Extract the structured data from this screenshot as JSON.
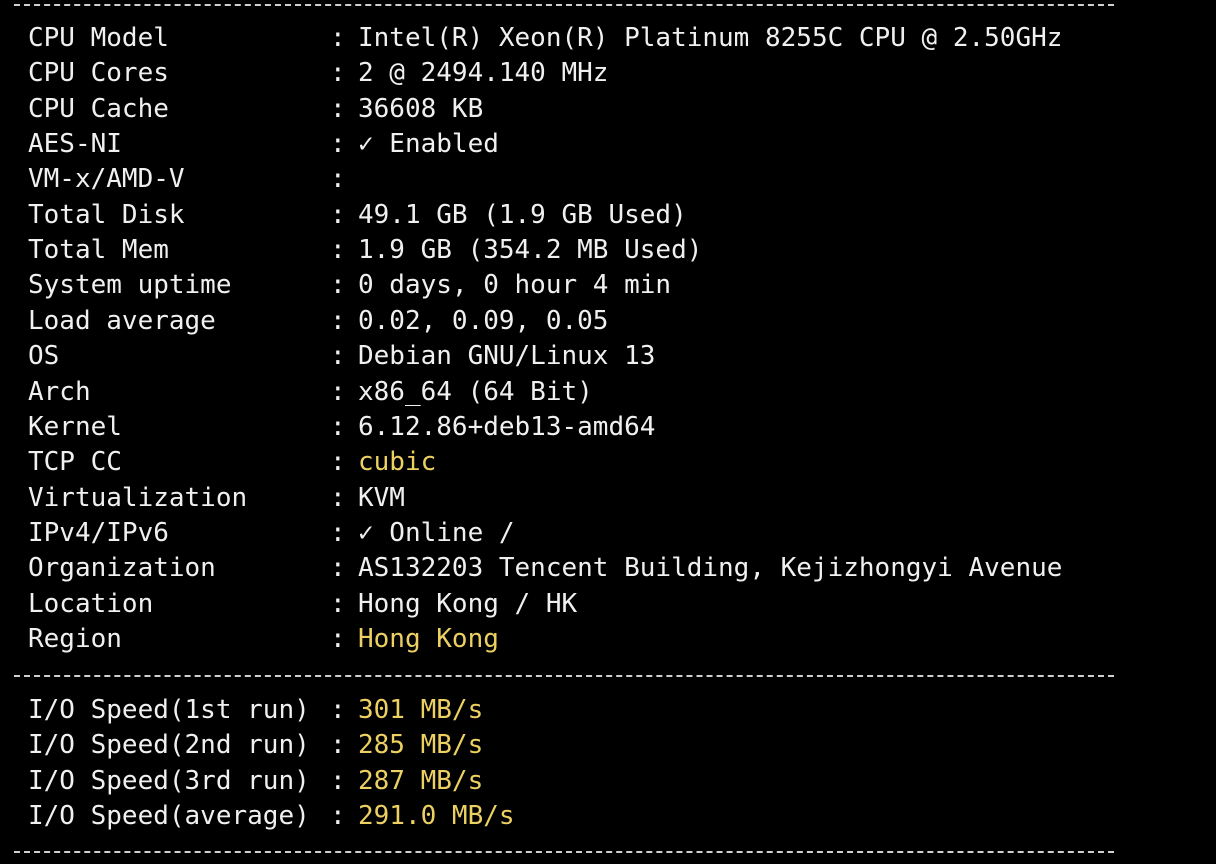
{
  "colors": {
    "background": "#000000",
    "text": "#f0f0f0",
    "highlight": "#ecd062"
  },
  "separator": ":",
  "system_info": [
    {
      "label": "CPU Model",
      "value": "Intel(R) Xeon(R) Platinum 8255C CPU @ 2.50GHz",
      "highlight": false
    },
    {
      "label": "CPU Cores",
      "value": "2 @ 2494.140 MHz",
      "highlight": false
    },
    {
      "label": "CPU Cache",
      "value": "36608 KB",
      "highlight": false
    },
    {
      "label": "AES-NI",
      "value": "✓ Enabled",
      "highlight": false
    },
    {
      "label": "VM-x/AMD-V",
      "value": "",
      "highlight": false
    },
    {
      "label": "Total Disk",
      "value": "49.1 GB (1.9 GB Used)",
      "highlight": false
    },
    {
      "label": "Total Mem",
      "value": "1.9 GB (354.2 MB Used)",
      "highlight": false
    },
    {
      "label": "System uptime",
      "value": "0 days, 0 hour 4 min",
      "highlight": false
    },
    {
      "label": "Load average",
      "value": "0.02, 0.09, 0.05",
      "highlight": false
    },
    {
      "label": "OS",
      "value": "Debian GNU/Linux 13",
      "highlight": false
    },
    {
      "label": "Arch",
      "value": "x86_64 (64 Bit)",
      "highlight": false
    },
    {
      "label": "Kernel",
      "value": "6.12.86+deb13-amd64",
      "highlight": false
    },
    {
      "label": "TCP CC",
      "value": "cubic",
      "highlight": true
    },
    {
      "label": "Virtualization",
      "value": "KVM",
      "highlight": false
    },
    {
      "label": "IPv4/IPv6",
      "value": "✓ Online /",
      "highlight": false
    },
    {
      "label": "Organization",
      "value": "AS132203 Tencent Building, Kejizhongyi Avenue",
      "highlight": false
    },
    {
      "label": "Location",
      "value": "Hong Kong / HK",
      "highlight": false
    },
    {
      "label": "Region",
      "value": "Hong Kong",
      "highlight": true
    }
  ],
  "io_speed": [
    {
      "label": "I/O Speed(1st run)",
      "value": "301 MB/s",
      "highlight": true
    },
    {
      "label": "I/O Speed(2nd run)",
      "value": "285 MB/s",
      "highlight": true
    },
    {
      "label": "I/O Speed(3rd run)",
      "value": "287 MB/s",
      "highlight": true
    },
    {
      "label": "I/O Speed(average)",
      "value": "291.0 MB/s",
      "highlight": true
    }
  ]
}
